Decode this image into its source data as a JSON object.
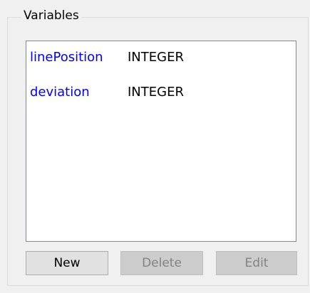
{
  "groupbox": {
    "title": "Variables"
  },
  "variables": [
    {
      "name": "linePosition",
      "type": "INTEGER"
    },
    {
      "name": "deviation",
      "type": "INTEGER"
    }
  ],
  "buttons": {
    "new_label": "New",
    "delete_label": "Delete",
    "edit_label": "Edit",
    "delete_enabled": false,
    "edit_enabled": false
  },
  "colors": {
    "variable_name": "#0000ff",
    "variable_type": "#000000",
    "window_background": "#f0f0f0",
    "disabled_text": "#838383"
  }
}
